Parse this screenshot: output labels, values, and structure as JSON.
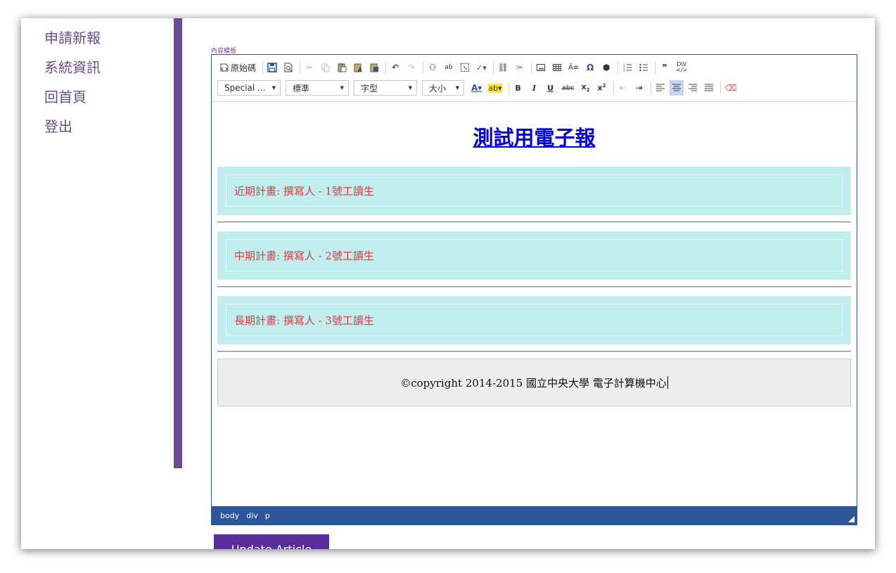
{
  "sidebar": {
    "items": [
      {
        "label": "申請新報"
      },
      {
        "label": "系統資訊"
      },
      {
        "label": "回首頁"
      },
      {
        "label": "登出"
      }
    ]
  },
  "editor": {
    "field_label": "內容模板",
    "toolbar": {
      "source_label": "原始碼",
      "styles_combo": "Special ...",
      "format_combo": "標準",
      "font_combo": "字型",
      "size_combo": "大小"
    },
    "content": {
      "title": "測試用電子報",
      "plans": [
        {
          "text": "近期計畫: 撰寫人 - 1號工讀生"
        },
        {
          "text": "中期計畫: 撰寫人 - 2號工讀生"
        },
        {
          "text": "長期計畫: 撰寫人 - 3號工讀生"
        }
      ],
      "footer": "©copyright 2014-2015 國立中央大學 電子計算機中心"
    },
    "statusbar": {
      "path": [
        "body",
        "div",
        "p"
      ]
    }
  },
  "submit_button": {
    "label": "Update Article"
  },
  "colors": {
    "accent": "#6a4c93",
    "editor_chrome": "#2b579a",
    "plan_background": "#c0eeee",
    "plan_text": "#e23b3b",
    "title_link": "#0000ee"
  }
}
